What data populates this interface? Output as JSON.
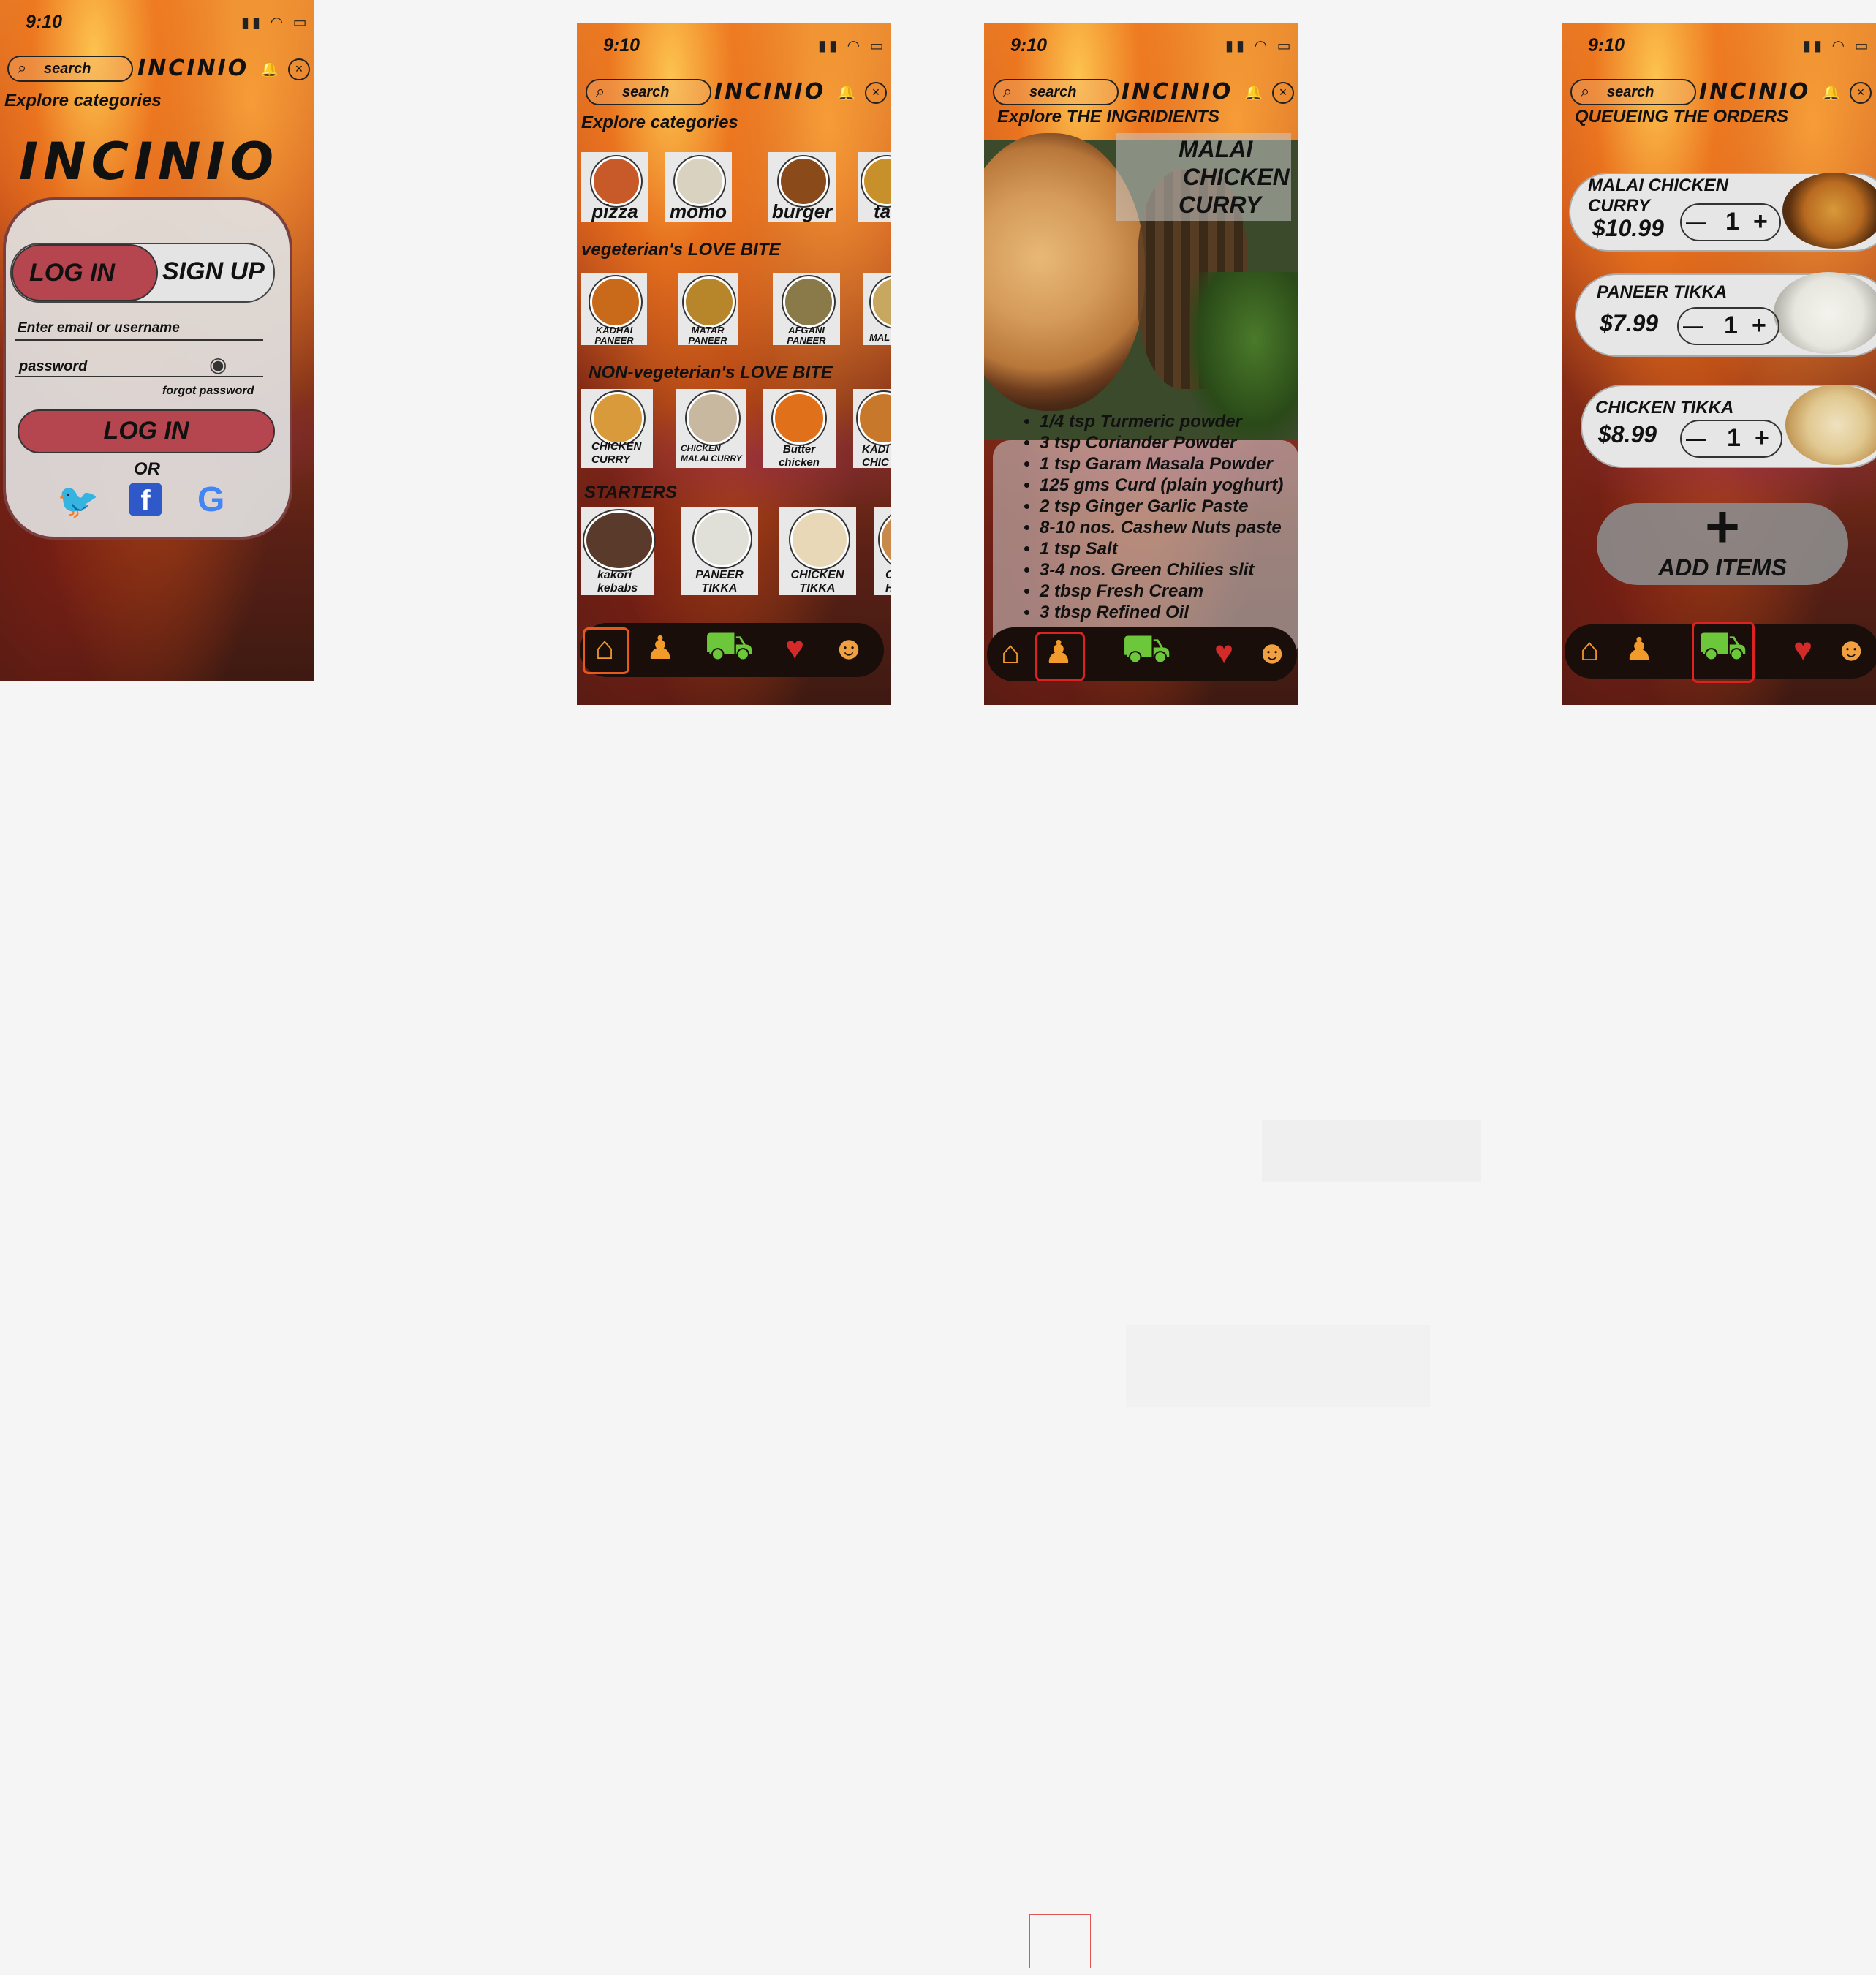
{
  "common": {
    "time": "9:10",
    "search_label": "search",
    "brand": "INCINIO",
    "close_glyph": "×"
  },
  "login": {
    "explore": "Explore categories",
    "hero": "INCINIO",
    "tab_login": "LOG IN",
    "tab_signup": "SIGN UP",
    "email_placeholder": "Enter email or username",
    "password_placeholder": "password",
    "forgot": "forgot password",
    "login_button": "LOG IN",
    "or": "OR"
  },
  "home": {
    "explore": "Explore categories",
    "categories": [
      {
        "label": "pizza",
        "color": "#c85a2a"
      },
      {
        "label": "momo",
        "color": "#d9d2c0"
      },
      {
        "label": "burger",
        "color": "#8a4a1a"
      },
      {
        "label": "ta",
        "color": "#c8902a"
      }
    ],
    "veg_title": "vegeterian's  LOVE BITE",
    "veg": [
      {
        "line1": "KADHAI",
        "line2": "PANEER",
        "color": "#c86a1a"
      },
      {
        "line1": "MATAR",
        "line2": "PANEER",
        "color": "#b8862a"
      },
      {
        "line1": "AFGANI",
        "line2": "PANEER",
        "color": "#8a7a4a"
      },
      {
        "line1": "MAL",
        "line2": "",
        "color": "#c8a860"
      }
    ],
    "nonveg_title": "NON-vegeterian's  LOVE BITE",
    "nonveg": [
      {
        "line1": "CHICKEN",
        "line2": "CURRY",
        "color": "#d89a3a"
      },
      {
        "line1": "CHICKEN",
        "line2": "MALAI CURRY",
        "color": "#c8b8a0"
      },
      {
        "line1": "Butter",
        "line2": "chicken",
        "color": "#e0701a"
      },
      {
        "line1": "KADI",
        "line2": "CHIC",
        "color": "#c8782a"
      }
    ],
    "starters_title": "STARTERS",
    "starters": [
      {
        "line1": "kakori",
        "line2": "kebabs",
        "color": "#5a3a2a"
      },
      {
        "line1": "PANEER",
        "line2": "TIKKA",
        "color": "#e0e0d8"
      },
      {
        "line1": "CHICKEN",
        "line2": "TIKKA",
        "color": "#e8d8b8"
      },
      {
        "line1": "C",
        "line2": "H",
        "color": "#c88a4a"
      }
    ]
  },
  "recipe": {
    "title": "Explore  THE  INGRIDIENTS",
    "dish_line1": "MALAI",
    "dish_line2": "CHICKEN",
    "dish_line3": "CURRY",
    "ingredients": [
      "1/4 tsp Turmeric powder",
      "3 tsp Coriander Powder",
      "1 tsp Garam Masala Powder",
      "125 gms Curd (plain yoghurt)",
      "2 tsp Ginger Garlic Paste",
      "8-10 nos. Cashew Nuts paste",
      "1 tsp Salt",
      "3-4 nos. Green Chilies slit",
      "2 tbsp Fresh Cream",
      "3 tbsp Refined Oil"
    ]
  },
  "orders": {
    "title": "QUEUEING THE ORDERS",
    "items": [
      {
        "name1": "MALAI CHICKEN",
        "name2": "CURRY",
        "price": "$10.99",
        "qty": "1",
        "minus": "—",
        "plus": "+"
      },
      {
        "name1": "PANEER TIKKA",
        "name2": "",
        "price": "$7.99",
        "qty": "1",
        "minus": "—",
        "plus": "+"
      },
      {
        "name1": "CHICKEN TIKKA",
        "name2": "",
        "price": "$8.99",
        "qty": "1",
        "minus": "—",
        "plus": "+"
      }
    ],
    "add_plus": "+",
    "add_label": "ADD ITEMS"
  },
  "nav_icons": [
    "home-icon",
    "chef-icon",
    "basket-icon",
    "heart-icon",
    "profile-icon"
  ],
  "colors": {
    "accent_red": "#b5454e",
    "nav_bg": "#1a0e0a",
    "basket_green": "#6cc83a",
    "heart_red": "#d42a2a",
    "home_orange": "#f29a2a"
  }
}
